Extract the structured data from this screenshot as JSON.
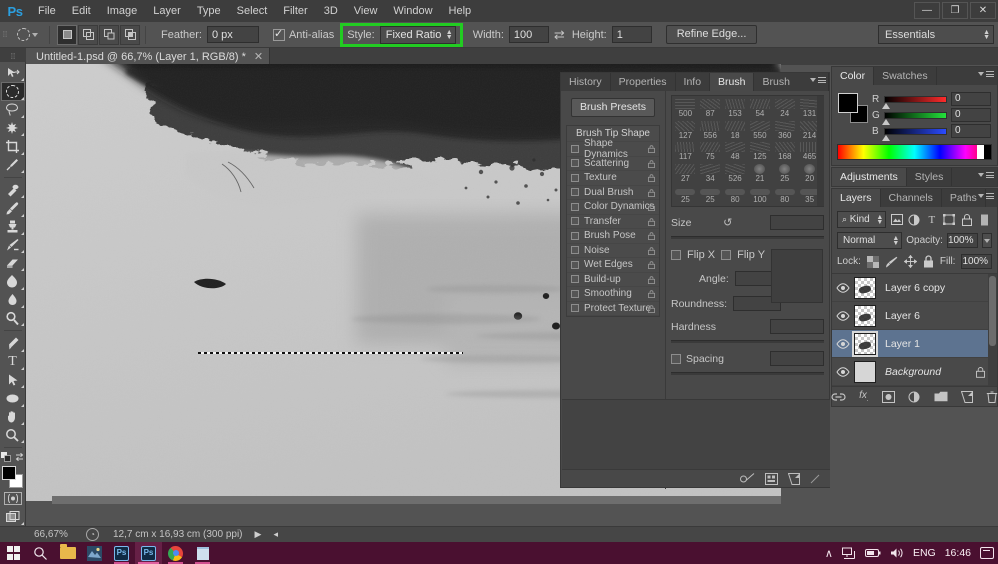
{
  "app": {
    "logo": "Ps",
    "menus": [
      "File",
      "Edit",
      "Image",
      "Layer",
      "Type",
      "Select",
      "Filter",
      "3D",
      "View",
      "Window",
      "Help"
    ],
    "window_controls": {
      "minimize": "—",
      "restore": "❐",
      "close": "✕"
    },
    "workspace": "Essentials"
  },
  "options_bar": {
    "feather_label": "Feather:",
    "feather_value": "0 px",
    "antialias_label": "Anti-alias",
    "antialias_checked": true,
    "style_label": "Style:",
    "style_value": "Fixed Ratio",
    "style_highlight_color": "#22cc22",
    "width_label": "Width:",
    "width_value": "100",
    "height_label": "Height:",
    "height_value": "1",
    "refine_edge_label": "Refine Edge...",
    "selection_modes": [
      "new-selection",
      "add-to-selection",
      "subtract-from-selection",
      "intersect-with-selection"
    ],
    "active_selection_mode": 0
  },
  "document": {
    "tab_title": "Untitled-1.psd @ 66,7% (Layer 1, RGB/8) *",
    "close_glyph": "✕"
  },
  "statusbar": {
    "zoom": "66,67%",
    "dimensions": "12,7 cm x 16,93 cm (300 ppi)",
    "arrow": "▶"
  },
  "toolbar": {
    "tools": [
      "move-tool",
      "elliptical-marquee-tool",
      "lasso-tool",
      "magic-wand-tool",
      "crop-tool",
      "eyedropper-tool",
      "healing-brush-tool",
      "brush-tool",
      "clone-stamp-tool",
      "history-brush-tool",
      "eraser-tool",
      "gradient-tool",
      "blur-tool",
      "dodge-tool",
      "pen-tool",
      "type-tool",
      "path-selection-tool",
      "shape-tool",
      "hand-tool",
      "zoom-tool"
    ],
    "active_tool_index": 1,
    "foreground_color": "#000000",
    "background_color": "#ffffff"
  },
  "brush_panel": {
    "tabs": [
      "History",
      "Properties",
      "Info",
      "Brush",
      "Brush Presets"
    ],
    "active_tab": "Brush",
    "presets_button": "Brush Presets",
    "options": [
      {
        "label": "Brush Tip Shape",
        "is_header": true,
        "checked": false,
        "locked": false
      },
      {
        "label": "Shape Dynamics",
        "is_header": false,
        "checked": false,
        "locked": true
      },
      {
        "label": "Scattering",
        "is_header": false,
        "checked": false,
        "locked": true
      },
      {
        "label": "Texture",
        "is_header": false,
        "checked": false,
        "locked": true
      },
      {
        "label": "Dual Brush",
        "is_header": false,
        "checked": false,
        "locked": true
      },
      {
        "label": "Color Dynamics",
        "is_header": false,
        "checked": false,
        "locked": true
      },
      {
        "label": "Transfer",
        "is_header": false,
        "checked": false,
        "locked": true
      },
      {
        "label": "Brush Pose",
        "is_header": false,
        "checked": false,
        "locked": true
      },
      {
        "label": "Noise",
        "is_header": false,
        "checked": false,
        "locked": true
      },
      {
        "label": "Wet Edges",
        "is_header": false,
        "checked": false,
        "locked": true
      },
      {
        "label": "Build-up",
        "is_header": false,
        "checked": false,
        "locked": true
      },
      {
        "label": "Smoothing",
        "is_header": false,
        "checked": false,
        "locked": true
      },
      {
        "label": "Protect Texture",
        "is_header": false,
        "checked": false,
        "locked": true
      }
    ],
    "lock_glyph": "🔒",
    "preset_sizes": [
      500,
      87,
      153,
      54,
      24,
      131,
      127,
      556,
      18,
      550,
      360,
      214,
      117,
      75,
      48,
      125,
      168,
      465,
      27,
      34,
      526,
      21,
      25,
      20,
      25,
      25,
      80,
      100,
      80,
      35
    ],
    "size_label": "Size",
    "size_value": "",
    "reset_glyph": "↺",
    "flip_x_label": "Flip X",
    "flip_y_label": "Flip Y",
    "flip_x_checked": false,
    "flip_y_checked": false,
    "angle_label": "Angle:",
    "angle_value": "",
    "roundness_label": "Roundness:",
    "roundness_value": "",
    "hardness_label": "Hardness",
    "hardness_value": "",
    "spacing_label": "Spacing",
    "spacing_checked": false,
    "spacing_value": "",
    "footer_icons": [
      "brush-stroke-icon",
      "new-preset-icon",
      "create-new-icon"
    ]
  },
  "color_panel": {
    "tabs": [
      "Color",
      "Swatches"
    ],
    "active_tab": "Color",
    "channels": [
      {
        "label": "R",
        "value": "0"
      },
      {
        "label": "G",
        "value": "0"
      },
      {
        "label": "B",
        "value": "0"
      }
    ]
  },
  "adjustments_panel": {
    "tabs": [
      "Adjustments",
      "Styles"
    ],
    "active_tab": "Adjustments"
  },
  "layers_panel": {
    "tabs": [
      "Layers",
      "Channels",
      "Paths"
    ],
    "active_tab": "Layers",
    "kind_filter": "Kind",
    "filter_icons": [
      "pixel-filter-icon",
      "adjustment-filter-icon",
      "type-filter-icon",
      "shape-filter-icon",
      "smart-object-filter-icon",
      "filter-toggle-icon"
    ],
    "blend_mode": "Normal",
    "opacity_label": "Opacity:",
    "opacity_value": "100%",
    "lock_label": "Lock:",
    "lock_icons": [
      "lock-transparent-pixels-icon",
      "lock-image-pixels-icon",
      "lock-position-icon",
      "lock-all-icon"
    ],
    "fill_label": "Fill:",
    "fill_value": "100%",
    "layers": [
      {
        "name": "Layer 6 copy",
        "visible": true,
        "selected": false,
        "locked": false,
        "italic": false,
        "transparent": true
      },
      {
        "name": "Layer 6",
        "visible": true,
        "selected": false,
        "locked": false,
        "italic": false,
        "transparent": true
      },
      {
        "name": "Layer 1",
        "visible": true,
        "selected": true,
        "locked": false,
        "italic": false,
        "transparent": true
      },
      {
        "name": "Background",
        "visible": true,
        "selected": false,
        "locked": true,
        "italic": true,
        "transparent": false
      }
    ],
    "eye_glyph": "👁",
    "lock_glyph": "🔒",
    "footer_icons": [
      "link-layers-icon",
      "add-style-icon",
      "add-mask-icon",
      "new-adjustment-icon",
      "new-group-icon",
      "new-layer-icon",
      "delete-layer-icon"
    ],
    "footer_labels": [
      "🔗",
      "fx",
      "◉",
      "◑",
      "▰",
      "⊿",
      "🗑"
    ]
  },
  "taskbar": {
    "items": [
      {
        "name": "start-button",
        "icon": "windows-icon"
      },
      {
        "name": "search-button",
        "icon": "search-icon"
      },
      {
        "name": "file-explorer-button",
        "icon": "folder-icon"
      },
      {
        "name": "app-button",
        "icon": "app-icon"
      },
      {
        "name": "photoshop-button-1",
        "icon": "photoshop-icon",
        "label": "Ps"
      },
      {
        "name": "photoshop-button-2",
        "icon": "photoshop-icon",
        "label": "Ps",
        "active": true
      },
      {
        "name": "chrome-button",
        "icon": "chrome-icon"
      },
      {
        "name": "notes-button",
        "icon": "notes-icon"
      }
    ],
    "tray": {
      "chevron": "∧",
      "network_icon": "network-icon",
      "battery_icon": "battery-icon",
      "volume_icon": "volume-icon",
      "language": "ENG",
      "clock": "16:46",
      "notification_icon": "notification-icon"
    }
  }
}
